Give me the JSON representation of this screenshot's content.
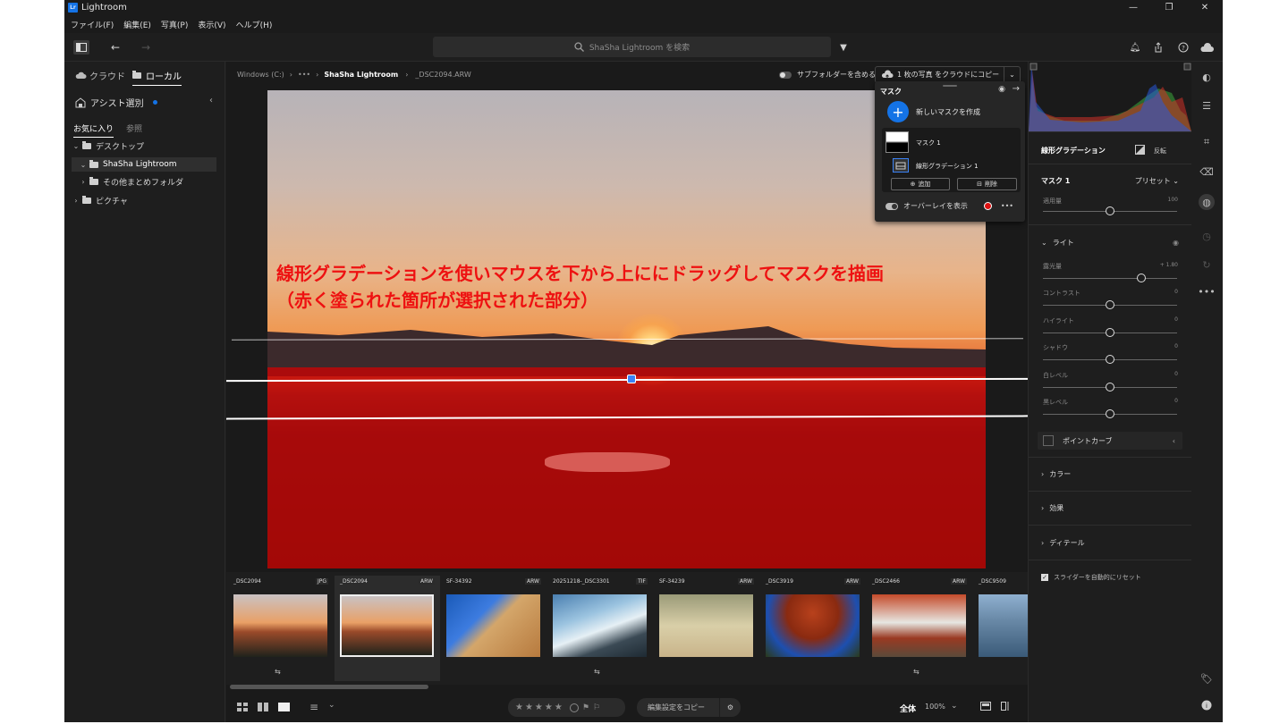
{
  "window": {
    "app_title": "Lightroom",
    "controls": [
      "—",
      "❐",
      "✕"
    ]
  },
  "menu": [
    "ファイル(F)",
    "編集(E)",
    "写真(P)",
    "表示(V)",
    "ヘルプ(H)"
  ],
  "search": {
    "placeholder": "ShaSha Lightroom を検索"
  },
  "left": {
    "tab_cloud": "クラウド",
    "tab_local": "ローカル",
    "assist": "アシスト選別",
    "sub_tabs": [
      "お気に入り",
      "参照"
    ],
    "tree": [
      {
        "label": "デスクトップ",
        "level": 0,
        "expanded": true
      },
      {
        "label": "ShaSha Lightroom",
        "level": 1,
        "expanded": true,
        "selected": true
      },
      {
        "label": "その他まとめフォルダ",
        "level": 1,
        "expanded": false
      },
      {
        "label": "ピクチャ",
        "level": 0,
        "expanded": false
      }
    ]
  },
  "breadcrumb": {
    "drive": "Windows (C:)",
    "ellipsis": "•••",
    "folder": "ShaSha Lightroom",
    "file": "_DSC2094.ARW",
    "subfolder_toggle": "サブフォルダーを含める",
    "copy_cloud": "1 枚の写真 をクラウドにコピー"
  },
  "annotation": {
    "line1": "線形グラデーションを使いマウスを下から上ににドラッグしてマスクを描画",
    "line2": "（赤く塗られた箇所が選択された部分）"
  },
  "mask_panel": {
    "title": "マスク",
    "new_mask": "新しいマスクを作成",
    "mask_name": "マスク 1",
    "component_name": "線形グラデーション 1",
    "add": "追加",
    "delete": "削除",
    "overlay": "オーバーレイを表示",
    "more": "•••"
  },
  "filmstrip": [
    {
      "name": "_DSC2094",
      "ext": "JPG",
      "synced": true,
      "selected": false
    },
    {
      "name": "_DSC2094",
      "ext": "ARW",
      "synced": false,
      "selected": true
    },
    {
      "name": "SF-34392",
      "ext": "ARW",
      "synced": false,
      "selected": false
    },
    {
      "name": "20251218-_DSC3301",
      "ext": "TIF",
      "synced": true,
      "selected": false
    },
    {
      "name": "SF-34239",
      "ext": "ARW",
      "synced": false,
      "selected": false
    },
    {
      "name": "_DSC3919",
      "ext": "ARW",
      "synced": false,
      "selected": false
    },
    {
      "name": "_DSC2466",
      "ext": "ARW",
      "synced": true,
      "selected": false
    },
    {
      "name": "_DSC9509",
      "ext": "",
      "synced": false,
      "selected": false
    }
  ],
  "bottom": {
    "stars": "★★★★★",
    "copy_settings": "編集設定をコピー",
    "fit": "全体",
    "zoom": "100%"
  },
  "right": {
    "header": "線形グラデーション",
    "invert": "反転",
    "mask_label": "マスク 1",
    "preset": "プリセット",
    "amount_label": "適用量",
    "amount_value": "100",
    "light_section": "ライト",
    "sliders": [
      {
        "label": "露光量",
        "value": "+ 1.80",
        "pos": 0.73
      },
      {
        "label": "コントラスト",
        "value": "0",
        "pos": 0.5
      },
      {
        "label": "ハイライト",
        "value": "0",
        "pos": 0.5
      },
      {
        "label": "シャドウ",
        "value": "0",
        "pos": 0.5
      },
      {
        "label": "白レベル",
        "value": "0",
        "pos": 0.5
      },
      {
        "label": "黒レベル",
        "value": "0",
        "pos": 0.5
      }
    ],
    "point_curve": "ポイントカーブ",
    "color_section": "カラー",
    "effects_section": "効果",
    "detail_section": "ディテール",
    "auto_reset": "スライダーを自動的にリセット"
  }
}
